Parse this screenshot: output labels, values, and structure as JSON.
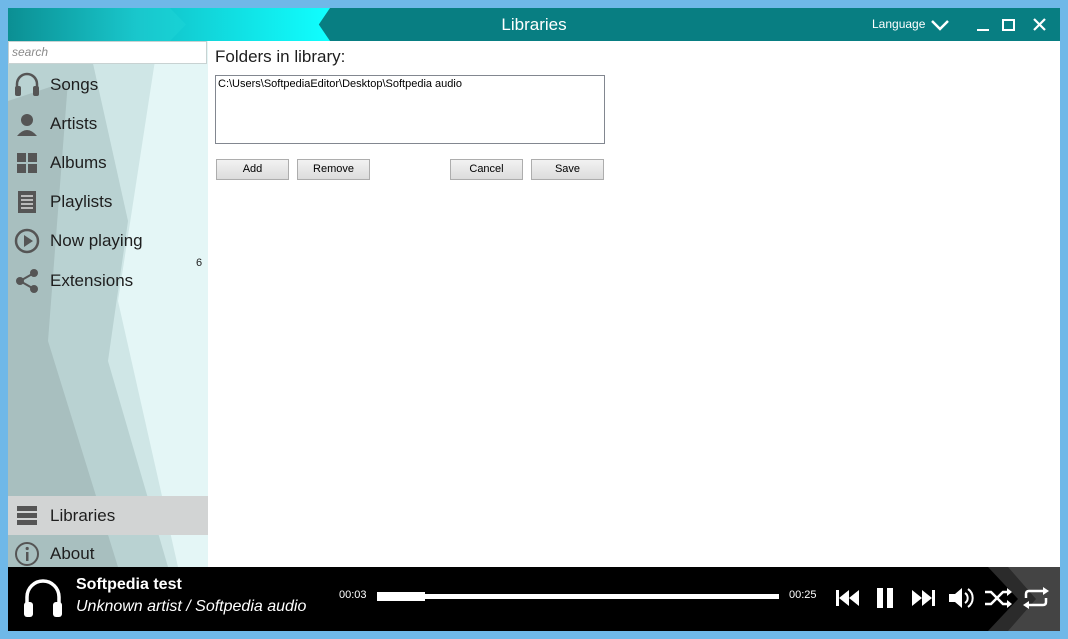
{
  "window": {
    "title": "Libraries",
    "language_label": "Language"
  },
  "search": {
    "placeholder": "search"
  },
  "sidebar": {
    "items": [
      {
        "label": "Songs",
        "icon": "headphones-icon"
      },
      {
        "label": "Artists",
        "icon": "person-icon"
      },
      {
        "label": "Albums",
        "icon": "grid-icon"
      },
      {
        "label": "Playlists",
        "icon": "list-icon"
      },
      {
        "label": "Now playing",
        "icon": "play-circle-icon"
      },
      {
        "label": "Extensions",
        "icon": "share-icon"
      }
    ],
    "now_playing_count": "6",
    "bottom_items": [
      {
        "label": "Libraries",
        "icon": "stack-icon",
        "active": true
      },
      {
        "label": "About",
        "icon": "info-icon"
      }
    ]
  },
  "content": {
    "heading": "Folders in library:",
    "folders": [
      "C:\\Users\\SoftpediaEditor\\Desktop\\Softpedia audio"
    ],
    "buttons": {
      "add": "Add",
      "remove": "Remove",
      "cancel": "Cancel",
      "save": "Save"
    }
  },
  "player": {
    "title": "Softpedia test",
    "subtitle": "Unknown artist / Softpedia audio",
    "elapsed": "00:03",
    "total": "00:25",
    "progress": 0.12
  },
  "colors": {
    "titlebar": "#087e82",
    "accent": "#12f2f2",
    "sidebar_bg": "#e4f6f6",
    "player_bg": "#000000"
  }
}
